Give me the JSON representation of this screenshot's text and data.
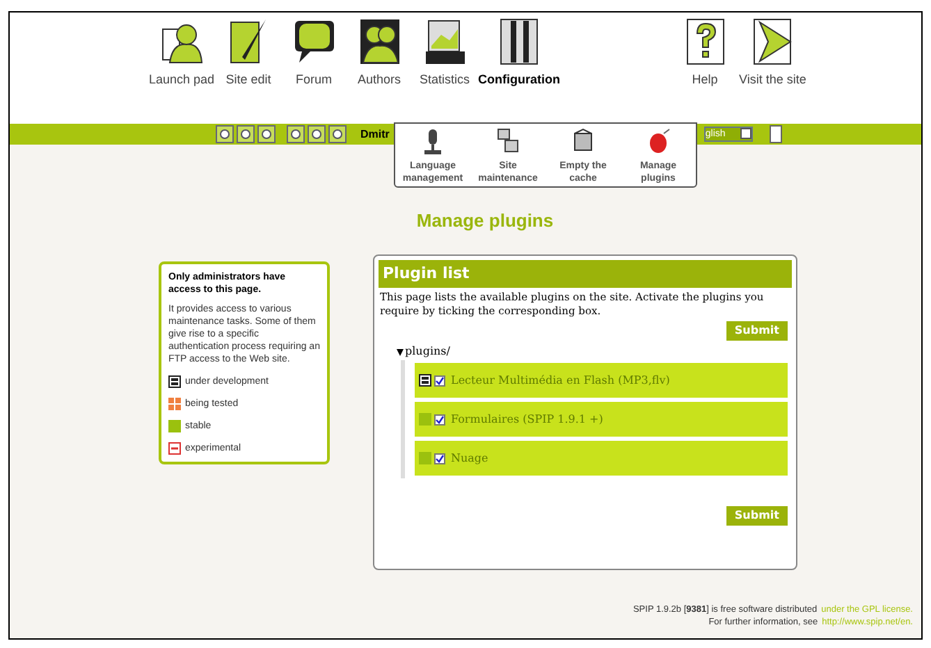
{
  "nav": [
    {
      "label": "Launch pad",
      "selected": false
    },
    {
      "label": "Site edit",
      "selected": false
    },
    {
      "label": "Forum",
      "selected": false
    },
    {
      "label": "Authors",
      "selected": false
    },
    {
      "label": "Statistics",
      "selected": false
    },
    {
      "label": "Configuration",
      "selected": true
    },
    {
      "label": "Help",
      "selected": false
    },
    {
      "label": "Visit the site",
      "selected": false
    }
  ],
  "toolbar": {
    "user": "Dmitr",
    "language": "glish"
  },
  "submenu": [
    {
      "label": "Language management"
    },
    {
      "label": "Site maintenance"
    },
    {
      "label": "Empty the cache"
    },
    {
      "label": "Manage plugins"
    }
  ],
  "heading": "Manage plugins",
  "info": {
    "title": "Only administrators have access to this page.",
    "text": "It provides access to various maintenance tasks. Some of them give rise to a specific authentication process requiring an FTP access to the Web site.",
    "legend": [
      {
        "kind": "dev",
        "label": "under development"
      },
      {
        "kind": "test",
        "label": "being tested"
      },
      {
        "kind": "stable",
        "label": "stable"
      },
      {
        "kind": "experimental",
        "label": "experimental"
      }
    ]
  },
  "panel": {
    "title": "Plugin list",
    "intro": "This page lists the available plugins on the site. Activate the plugins you require by ticking the corresponding box.",
    "submit": "Submit",
    "folder": "plugins/",
    "expanded": true,
    "plugins": [
      {
        "name": "Lecteur Multimédia en Flash (MP3,flv)",
        "kind": "dev",
        "checked": true
      },
      {
        "name": "Formulaires (SPIP 1.9.1 +)",
        "kind": "stable",
        "checked": true
      },
      {
        "name": "Nuage",
        "kind": "stable",
        "checked": true
      }
    ],
    "submit_bottom": "Submit"
  },
  "footer": {
    "line1": "SPIP 1.9.2b [**9381**] is free software distributed",
    "link1": "under the GPL license.",
    "line2": "For further information, see",
    "link2": "http://www.spip.net/en."
  }
}
